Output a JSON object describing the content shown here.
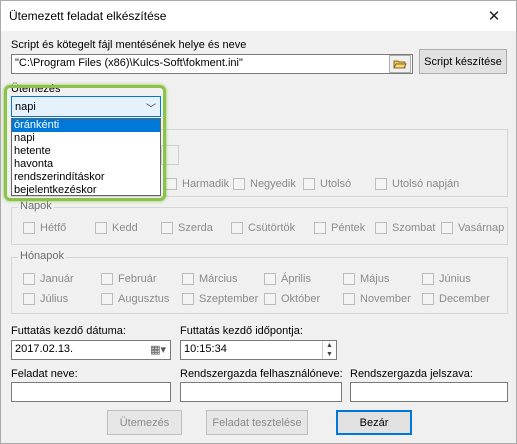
{
  "window": {
    "title": "Ütemezett feladat elkészítése"
  },
  "script_path": {
    "label": "Script és kötegelt fájl mentésének helye és neve",
    "value": "\"C:\\Program Files (x86)\\Kulcs-Soft\\fokment.ini\"",
    "create_button": "Script készítése"
  },
  "schedule": {
    "label": "Ütemezés",
    "selected": "napi",
    "options": [
      "óránkénti",
      "napi",
      "hetente",
      "havonta",
      "rendszerindításkor",
      "bejelentkezéskor"
    ]
  },
  "weeks_row": [
    "Harmadik",
    "Negyedik",
    "Utolsó",
    "Utolsó napján"
  ],
  "days": {
    "title": "Napok",
    "items": [
      "Hétfő",
      "Kedd",
      "Szerda",
      "Csütörtök",
      "Péntek",
      "Szombat",
      "Vasárnap"
    ]
  },
  "months": {
    "title": "Hónapok",
    "row1": [
      "Január",
      "Február",
      "Március",
      "Április",
      "Május",
      "Június"
    ],
    "row2": [
      "Július",
      "Augusztus",
      "Szeptember",
      "Október",
      "November",
      "December"
    ]
  },
  "start_date": {
    "label": "Futtatás kezdő dátuma:",
    "value": "2017.02.13."
  },
  "start_time": {
    "label": "Futtatás kezdő időpontja:",
    "value": "10:15:34"
  },
  "task_name": {
    "label": "Feladat neve:",
    "value": ""
  },
  "admin_user": {
    "label": "Rendszergazda felhasználóneve:",
    "value": ""
  },
  "admin_pass": {
    "label": "Rendszergazda jelszava:",
    "value": ""
  },
  "buttons": {
    "schedule": "Ütemezés",
    "test": "Feladat tesztelése",
    "close": "Bezár"
  },
  "accent_color": "#0078d7",
  "highlight_color": "#8bc34a"
}
